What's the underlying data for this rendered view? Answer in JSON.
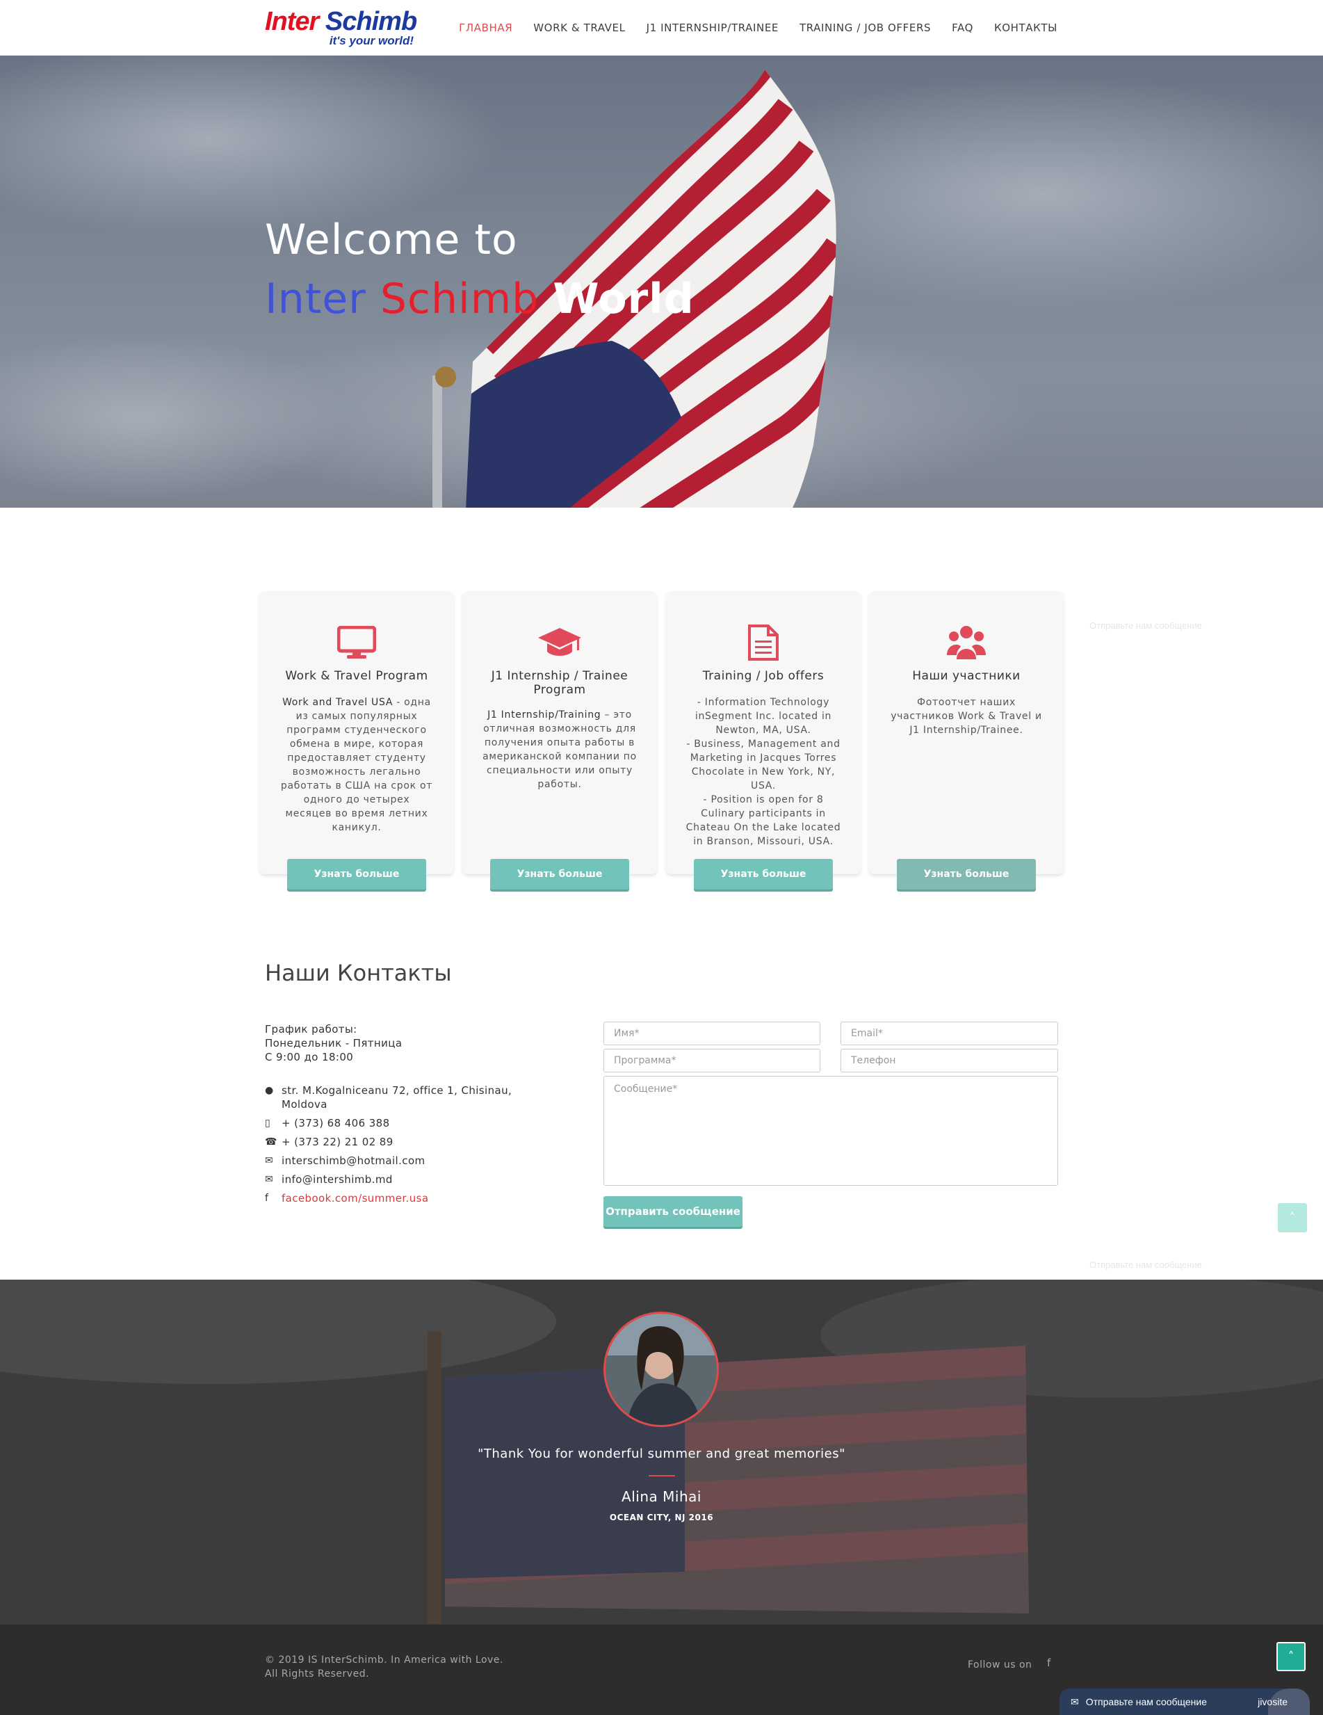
{
  "header": {
    "logo": {
      "word1": "Inter",
      "word2": "Schimb",
      "tagline": "it's your world!"
    },
    "nav": [
      {
        "label": "ГЛАВНАЯ",
        "active": true
      },
      {
        "label": "WORK & TRAVEL",
        "active": false
      },
      {
        "label": "J1 INTERNSHIP/TRAINEE",
        "active": false
      },
      {
        "label": "TRAINING / JOB OFFERS",
        "active": false
      },
      {
        "label": "FAQ",
        "active": false
      },
      {
        "label": "КОНТАКТЫ",
        "active": false
      }
    ]
  },
  "hero": {
    "line1": "Welcome to",
    "w1": "Inter",
    "w2": "Schimb",
    "w3": "World"
  },
  "features": [
    {
      "icon": "monitor-icon",
      "title": "Work & Travel Program",
      "body_bold": "Work and Travel USA",
      "body": " - одна из самых популярных программ студенческого обмена в мире, которая предоставляет студенту возможность легально работать в США на срок от одного до четырех месяцев во время летних каникул.",
      "button": "Узнать больше"
    },
    {
      "icon": "graduation-cap-icon",
      "title": "J1 Internship / Trainee Program",
      "body_bold": "J1 Internship/Training",
      "body": " – это отличная возможность для получения опыта работы в американской компании по специальности или опыту работы.",
      "button": "Узнать больше"
    },
    {
      "icon": "document-icon",
      "title": "Training / Job offers",
      "body_lines": [
        "- Information Technology inSegment Inc. located in Newton, MA, USA.",
        "- Business, Management and Marketing in Jacques Torres Chocolate in New York, NY, USA.",
        "- Position is open for 8 Culinary participants in Chateau On the Lake located in Branson, Missouri, USA."
      ],
      "button": "Узнать больше"
    },
    {
      "icon": "users-icon",
      "title": "Наши участники",
      "body": "Фотоотчет наших участников Work & Travel и J1 Internship/Trainee.",
      "button": "Узнать больше"
    }
  ],
  "ghost_text": "Отправьте нам сообщение",
  "contacts": {
    "title": "Наши Контакты",
    "hours": [
      "График работы:",
      "Понедельник - Пятница",
      "С 9:00 до 18:00"
    ],
    "address": "str. M.Kogalniceanu 72, office 1, Chisinau, Moldova",
    "mobile": "+ (373) 68 406 388",
    "phone": "+ (373 22) 21 02 89",
    "email1": "interschimb@hotmail.com",
    "email2": "info@intershimb.md",
    "facebook": "facebook.com/summer.usa"
  },
  "form": {
    "name_ph": "Имя*",
    "email_ph": "Email*",
    "program_ph": "Программа*",
    "phone_ph": "Телефон",
    "message_ph": "Сообщение*",
    "submit": "Отправить сообщение"
  },
  "testimonial": {
    "quote": "\"Thank You for wonderful summer and great memories\"",
    "name": "Alina Mihai",
    "location": "OCEAN CITY, NJ 2016"
  },
  "footer": {
    "copyright1": "© 2019 IS InterSchimb. In America with Love.",
    "copyright2": "All Rights Reserved.",
    "follow": "Follow us on",
    "follow_icon": "facebook-icon"
  },
  "chat": {
    "label": "Отправьте нам сообщение",
    "brand": "jivosite"
  },
  "colors": {
    "accent": "#e04a4a",
    "teal": "#72c4ba",
    "blue": "#4053d8",
    "red": "#e5202c",
    "footer": "#2d2d2d"
  }
}
